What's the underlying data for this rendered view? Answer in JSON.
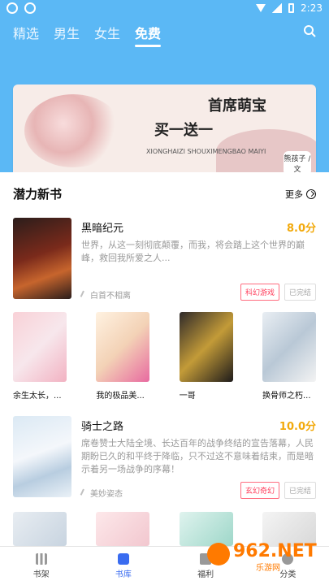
{
  "status": {
    "time": "2:23"
  },
  "tabs": [
    {
      "label": "精选"
    },
    {
      "label": "男生"
    },
    {
      "label": "女生"
    },
    {
      "label": "免费",
      "active": true
    }
  ],
  "banner": {
    "line1": "首席萌宝",
    "line2": "买一送一",
    "tiny": "XIONGHAIZI\nSHOUXIMENGBAO MAIYI",
    "author": "熊孩子\n/文"
  },
  "section": {
    "title": "潜力新书",
    "more": "更多"
  },
  "books": [
    {
      "title": "黑暗纪元",
      "score": "8.0分",
      "desc": "世界，从这一刻彻底颠覆，而我，将会踏上这个世界的巅峰，救回我所爱之人...",
      "author": "白首不相离",
      "tags": [
        "科幻游戏",
        "已完结"
      ]
    },
    {
      "title": "骑士之路",
      "score": "10.0分",
      "desc": "席卷赞士大陆全境、长达百年的战争终结的宣告落幕，人民期盼已久的和平终于降临，只不过这不意味着结束，而是暗示着另一场战争的序幕！",
      "author": "美妙姿态",
      "tags": [
        "玄幻奇幻",
        "已完结"
      ]
    }
  ],
  "grid": [
    {
      "title": "余生太长，..."
    },
    {
      "title": "我的极品美..."
    },
    {
      "title": "一哥"
    },
    {
      "title": "换骨师之朽..."
    }
  ],
  "nav": [
    {
      "label": "书架"
    },
    {
      "label": "书库",
      "active": true
    },
    {
      "label": "福利"
    },
    {
      "label": "分类"
    }
  ],
  "watermark": {
    "main": "962.NET",
    "sub": "乐游网"
  },
  "colors": {
    "accent": "#5bb8f5",
    "score": "#f2a90b",
    "tag_red": "#ff3b59",
    "nav_active": "#3a6cf0"
  }
}
